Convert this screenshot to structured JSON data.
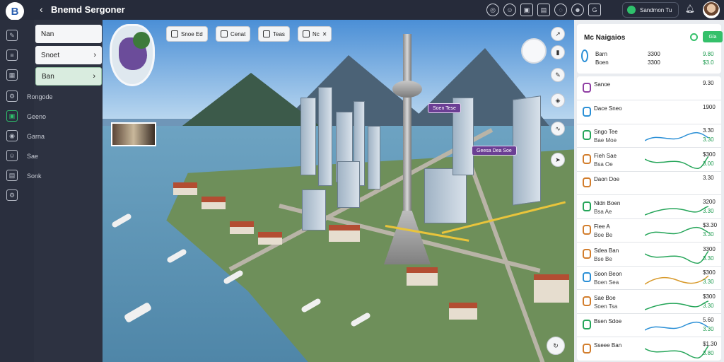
{
  "app": {
    "title": "Bnemd Sergoner",
    "logo_glyph": "B",
    "status_text": "Sandmon Tu"
  },
  "sidebar": {
    "buttons": [
      {
        "label": "Nan"
      },
      {
        "label": "Snoet"
      },
      {
        "label": "Ban"
      }
    ],
    "labels": [
      "Rongode",
      "Geeno",
      "Garna",
      "Sae",
      "Sonk"
    ]
  },
  "map": {
    "chips": [
      {
        "label": "Snoe Ed"
      },
      {
        "label": "Cenat"
      },
      {
        "label": "Teas"
      },
      {
        "label": "Nc"
      }
    ],
    "tags": [
      "Soen Tese",
      "Geesa Dea Soe"
    ]
  },
  "panel": {
    "title": "Mc Naigaios",
    "button": "Gla",
    "header": {
      "label_a": "Barn",
      "label_b": "Boen",
      "val_a": "3300",
      "val_b": "3300",
      "pct_a": "9.80",
      "pct_b": "$3.0"
    },
    "rows": [
      {
        "label": "Sanoe",
        "sub": "",
        "val": "9.30",
        "delta": "",
        "color": "#8f3da3",
        "spark": ""
      },
      {
        "label": "Dace Sneo",
        "sub": "",
        "val": "1900",
        "delta": "",
        "color": "#2a8fd6",
        "spark": ""
      },
      {
        "label": "Sngo Tee",
        "sub": "Bae Moe",
        "val": "3.30",
        "delta": "3.30",
        "color": "#25a559",
        "spark": "#2a8fd6"
      },
      {
        "label": "Fieh Sae",
        "sub": "Bsa Oe",
        "val": "$300",
        "delta": "3.00",
        "color": "#d27d2c",
        "spark": "#25a559"
      },
      {
        "label": "Daon Doe",
        "sub": "",
        "val": "3.30",
        "delta": "",
        "color": "#d27d2c",
        "spark": ""
      },
      {
        "label": "Nidn Boen",
        "sub": "Bsa Ae",
        "val": "3200",
        "delta": "3.30",
        "color": "#25a559",
        "spark": "#25a559"
      },
      {
        "label": "Fiee A",
        "sub": "Boe Be",
        "val": "$3.30",
        "delta": "3.30",
        "color": "#d27d2c",
        "spark": "#25a559"
      },
      {
        "label": "Sdea Ban",
        "sub": "Bse Be",
        "val": "3300",
        "delta": "3.30",
        "color": "#d27d2c",
        "spark": "#25a559"
      },
      {
        "label": "Soon Beon",
        "sub": "Boen Sea",
        "val": "$300",
        "delta": "3.30",
        "color": "#2a8fd6",
        "spark": "#d89a2c"
      },
      {
        "label": "Sae Boe",
        "sub": "Soen Tsa",
        "val": "$300",
        "delta": "3.30",
        "color": "#d27d2c",
        "spark": "#25a559"
      },
      {
        "label": "Bsen Sdoe",
        "sub": "",
        "val": "5.60",
        "delta": "3.30",
        "color": "#25a559",
        "spark": "#2a8fd6"
      },
      {
        "label": "Sseee Ban",
        "sub": "",
        "val": "$1.30",
        "delta": "3.80",
        "color": "#d27d2c",
        "spark": "#25a559"
      }
    ]
  }
}
